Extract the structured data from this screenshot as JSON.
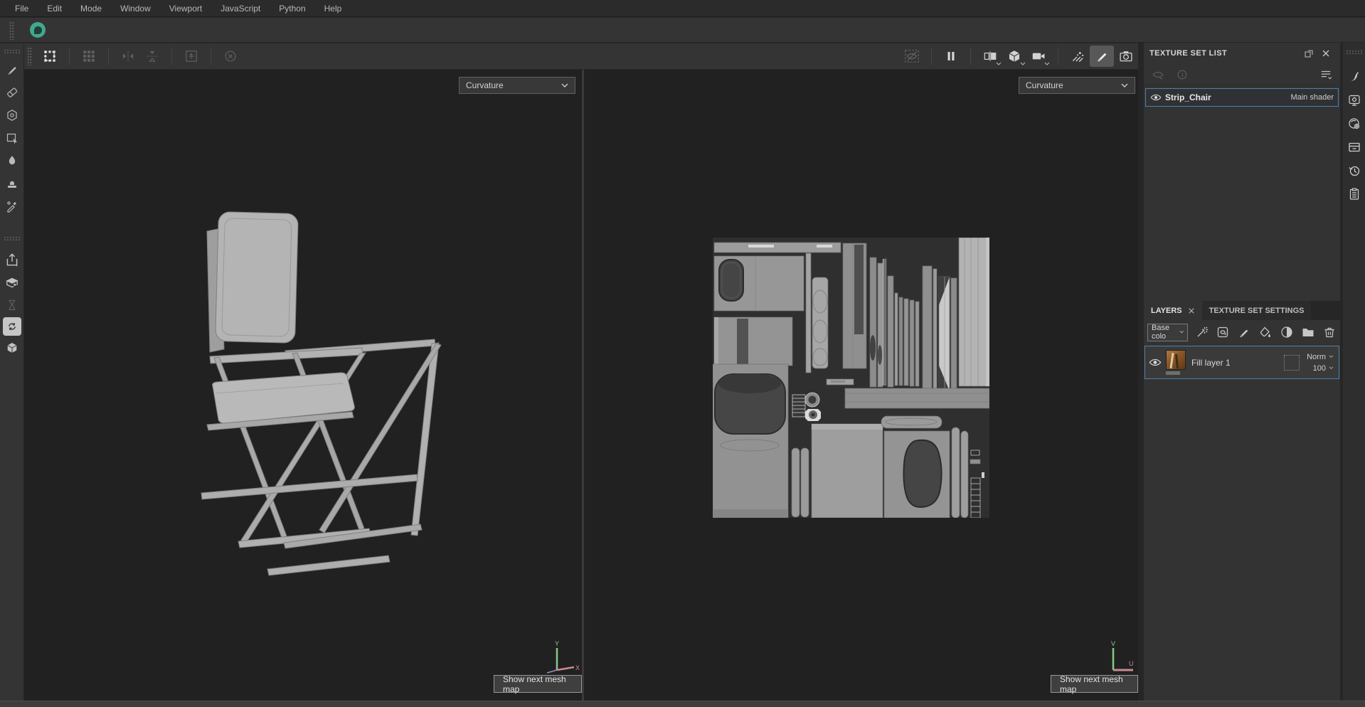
{
  "menu_bar": {
    "items": [
      "File",
      "Edit",
      "Mode",
      "Window",
      "Viewport",
      "JavaScript",
      "Python",
      "Help"
    ]
  },
  "top_toolbar": {
    "left_tools": [
      "transform",
      "uv-tile-grid",
      "mirror-horizontal",
      "mirror-vertical",
      "pivot-frame",
      "reset-rotation"
    ],
    "right_tools": [
      "toggle-mask-visibility",
      "pause-engine",
      "split-2d-3d-view",
      "3d-only-view",
      "camera-view",
      "particle-brush",
      "paint-brush",
      "screenshot-camera"
    ],
    "active_tool": "paint-brush"
  },
  "tool_sidebar": {
    "tools": [
      "paint",
      "eraser",
      "projection",
      "polygon-fill",
      "smudge",
      "clone",
      "material-picker",
      "export-textures",
      "geometry-mask",
      "bake-mesh-maps",
      "resources-updater",
      "assets"
    ]
  },
  "viewport_3d": {
    "map_dropdown_value": "Curvature",
    "overlay_button": "Show next mesh map",
    "axes": {
      "vertical": "Y",
      "horizontal": "X"
    }
  },
  "viewport_2d": {
    "map_dropdown_value": "Curvature",
    "overlay_button": "Show next mesh map",
    "axes": {
      "vertical": "V",
      "horizontal": "U"
    }
  },
  "texture_set_list_panel": {
    "title": "TEXTURE SET LIST",
    "sets": [
      {
        "name": "Strip_Chair",
        "shader": "Main shader",
        "selected": true,
        "visible": true
      }
    ]
  },
  "layers_panel": {
    "tabs": [
      "LAYERS",
      "TEXTURE SET SETTINGS"
    ],
    "active_tab": "LAYERS",
    "channel_filter": "Base colo",
    "layers": [
      {
        "name": "Fill layer 1",
        "blend_mode": "Norm",
        "opacity": "100",
        "visible": true,
        "selected": true
      }
    ]
  },
  "colors": {
    "selection_accent": "#4d80ad",
    "logo_green": "#43a78f",
    "axis_green": "#86c986",
    "axis_red": "#c98c8c"
  }
}
